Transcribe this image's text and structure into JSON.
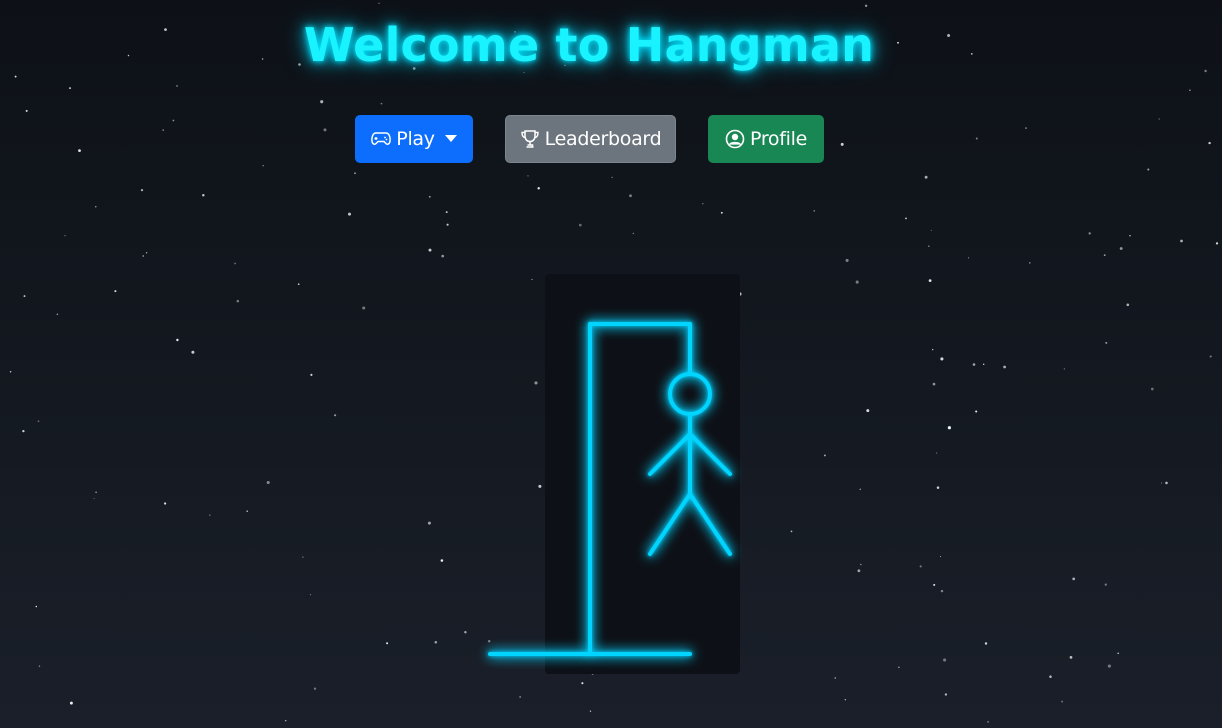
{
  "title": "Welcome to Hangman",
  "nav": {
    "play": {
      "label": "Play",
      "icon": "gamepad-icon",
      "color": "#0d6efd",
      "has_dropdown": true
    },
    "leaderboard": {
      "label": "Leaderboard",
      "icon": "trophy-icon",
      "color": "#6c757d"
    },
    "profile": {
      "label": "Profile",
      "icon": "user-circle-icon",
      "color": "#198754"
    }
  },
  "hangman": {
    "stage": "full-figure",
    "parts_shown": [
      "base",
      "pole",
      "beam",
      "rope",
      "head",
      "body",
      "left-arm",
      "right-arm",
      "left-leg",
      "right-leg"
    ],
    "neon_color": "#00d4ff"
  },
  "theme": {
    "background": "#0d1117",
    "title_color": "#19f2ff"
  }
}
